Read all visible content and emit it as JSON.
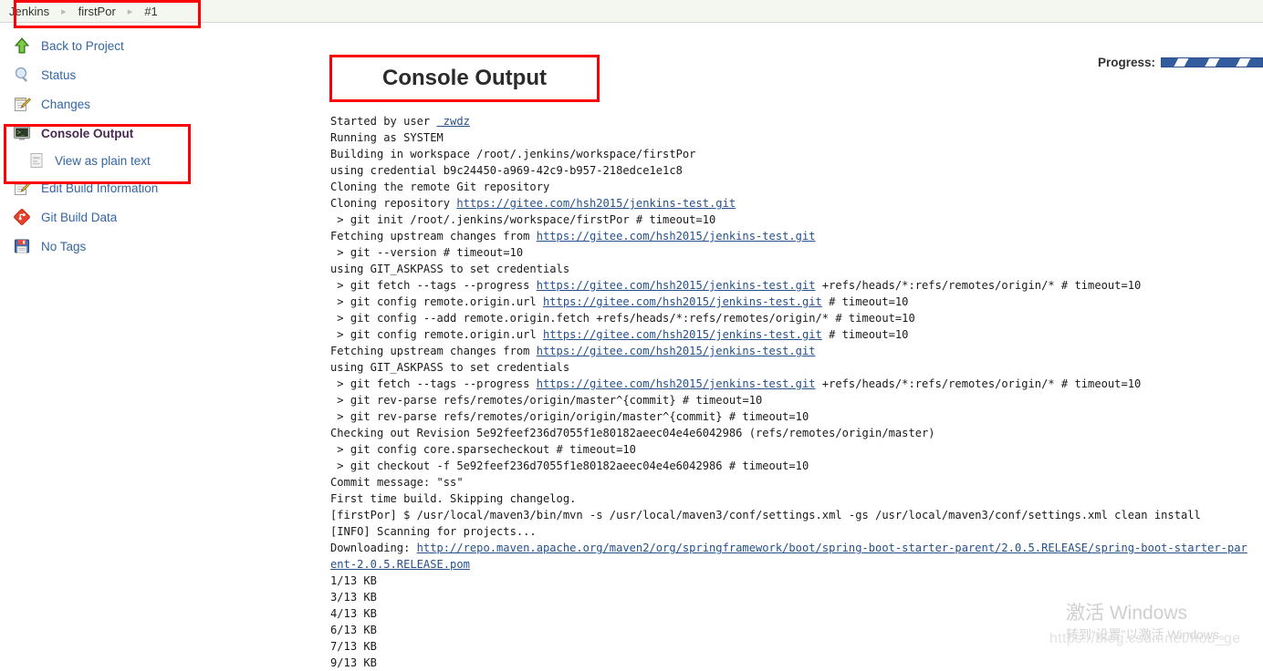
{
  "breadcrumb": {
    "items": [
      "Jenkins",
      "firstPor",
      "#1"
    ],
    "separator": "▸"
  },
  "sidebar": {
    "items": [
      {
        "label": "Back to Project",
        "icon": "up-arrow-icon",
        "active": false
      },
      {
        "label": "Status",
        "icon": "magnifier-icon",
        "active": false
      },
      {
        "label": "Changes",
        "icon": "notepad-pencil-icon",
        "active": false
      },
      {
        "label": "Console Output",
        "icon": "terminal-icon",
        "active": true
      },
      {
        "label": "Edit Build Information",
        "icon": "notepad-pencil-icon",
        "active": false
      },
      {
        "label": "Git Build Data",
        "icon": "git-diamond-icon",
        "active": false
      },
      {
        "label": "No Tags",
        "icon": "floppy-disk-icon",
        "active": false
      }
    ],
    "sub_item": {
      "label": "View as plain text",
      "icon": "document-icon"
    }
  },
  "main": {
    "title": "Console Output",
    "progress_label": "Progress:",
    "progress_percent": 100
  },
  "console": {
    "lines": [
      [
        {
          "t": "Started by user ",
          "k": "text"
        },
        {
          "t": " zwdz",
          "k": "link"
        }
      ],
      [
        {
          "t": "Running as SYSTEM",
          "k": "text"
        }
      ],
      [
        {
          "t": "Building in workspace /root/.jenkins/workspace/firstPor",
          "k": "text"
        }
      ],
      [
        {
          "t": "using credential b9c24450-a969-42c9-b957-218edce1e1c8",
          "k": "text"
        }
      ],
      [
        {
          "t": "Cloning the remote Git repository",
          "k": "text"
        }
      ],
      [
        {
          "t": "Cloning repository ",
          "k": "text"
        },
        {
          "t": "https://gitee.com/hsh2015/jenkins-test.git",
          "k": "link"
        }
      ],
      [
        {
          "t": " > git init /root/.jenkins/workspace/firstPor # timeout=10",
          "k": "text"
        }
      ],
      [
        {
          "t": "Fetching upstream changes from ",
          "k": "text"
        },
        {
          "t": "https://gitee.com/hsh2015/jenkins-test.git",
          "k": "link"
        }
      ],
      [
        {
          "t": " > git --version # timeout=10",
          "k": "text"
        }
      ],
      [
        {
          "t": "using GIT_ASKPASS to set credentials ",
          "k": "text"
        }
      ],
      [
        {
          "t": " > git fetch --tags --progress ",
          "k": "text"
        },
        {
          "t": "https://gitee.com/hsh2015/jenkins-test.git",
          "k": "link"
        },
        {
          "t": " +refs/heads/*:refs/remotes/origin/* # timeout=10",
          "k": "text"
        }
      ],
      [
        {
          "t": " > git config remote.origin.url ",
          "k": "text"
        },
        {
          "t": "https://gitee.com/hsh2015/jenkins-test.git",
          "k": "link"
        },
        {
          "t": " # timeout=10",
          "k": "text"
        }
      ],
      [
        {
          "t": " > git config --add remote.origin.fetch +refs/heads/*:refs/remotes/origin/* # timeout=10",
          "k": "text"
        }
      ],
      [
        {
          "t": " > git config remote.origin.url ",
          "k": "text"
        },
        {
          "t": "https://gitee.com/hsh2015/jenkins-test.git",
          "k": "link"
        },
        {
          "t": " # timeout=10",
          "k": "text"
        }
      ],
      [
        {
          "t": "Fetching upstream changes from ",
          "k": "text"
        },
        {
          "t": "https://gitee.com/hsh2015/jenkins-test.git",
          "k": "link"
        }
      ],
      [
        {
          "t": "using GIT_ASKPASS to set credentials ",
          "k": "text"
        }
      ],
      [
        {
          "t": " > git fetch --tags --progress ",
          "k": "text"
        },
        {
          "t": "https://gitee.com/hsh2015/jenkins-test.git",
          "k": "link"
        },
        {
          "t": " +refs/heads/*:refs/remotes/origin/* # timeout=10",
          "k": "text"
        }
      ],
      [
        {
          "t": " > git rev-parse refs/remotes/origin/master^{commit} # timeout=10",
          "k": "text"
        }
      ],
      [
        {
          "t": " > git rev-parse refs/remotes/origin/origin/master^{commit} # timeout=10",
          "k": "text"
        }
      ],
      [
        {
          "t": "Checking out Revision 5e92feef236d7055f1e80182aeec04e4e6042986 (refs/remotes/origin/master)",
          "k": "text"
        }
      ],
      [
        {
          "t": " > git config core.sparsecheckout # timeout=10",
          "k": "text"
        }
      ],
      [
        {
          "t": " > git checkout -f 5e92feef236d7055f1e80182aeec04e4e6042986 # timeout=10",
          "k": "text"
        }
      ],
      [
        {
          "t": "Commit message: \"ss\"",
          "k": "text"
        }
      ],
      [
        {
          "t": "First time build. Skipping changelog.",
          "k": "text"
        }
      ],
      [
        {
          "t": "[firstPor] $ /usr/local/maven3/bin/mvn -s /usr/local/maven3/conf/settings.xml -gs /usr/local/maven3/conf/settings.xml clean install",
          "k": "text"
        }
      ],
      [
        {
          "t": "[INFO] Scanning for projects...",
          "k": "text"
        }
      ],
      [
        {
          "t": "Downloading: ",
          "k": "text"
        },
        {
          "t": "http://repo.maven.apache.org/maven2/org/springframework/boot/spring-boot-starter-parent/2.0.5.RELEASE/spring-boot-starter-parent-2.0.5.RELEASE.pom",
          "k": "link"
        }
      ],
      [
        {
          "t": "1/13 KB",
          "k": "text"
        }
      ],
      [
        {
          "t": "3/13 KB",
          "k": "text"
        }
      ],
      [
        {
          "t": "4/13 KB",
          "k": "text"
        }
      ],
      [
        {
          "t": "6/13 KB",
          "k": "text"
        }
      ],
      [
        {
          "t": "7/13 KB",
          "k": "text"
        }
      ],
      [
        {
          "t": "9/13 KB",
          "k": "text"
        }
      ]
    ]
  },
  "watermark": {
    "title": "激活 Windows",
    "subtitle": "转到“设置”以激活 Windows。",
    "url": "https://blog.csdn.net/hou_ge"
  },
  "annotations": {
    "color": "#fb0007",
    "boxes": [
      "breadcrumb-highlight",
      "console-output-sidebar-highlight",
      "console-output-title-highlight"
    ]
  }
}
